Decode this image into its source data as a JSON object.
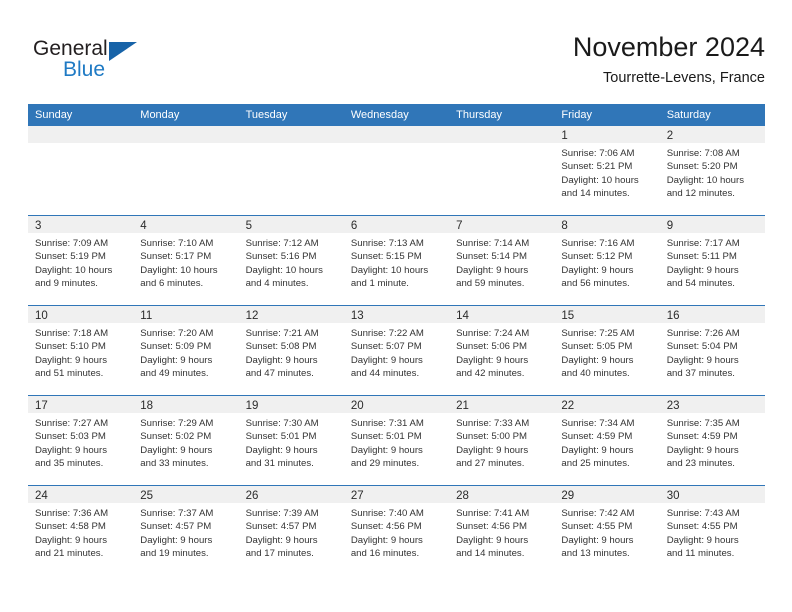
{
  "brand": {
    "name_part1": "General",
    "name_part2": "Blue",
    "accent_color": "#1f7ac4",
    "triangle_color": "#1763a8",
    "triangle_icon": "triangle-icon"
  },
  "header": {
    "month_title": "November 2024",
    "location": "Tourrette-Levens, France"
  },
  "calendar": {
    "header_bg": "#3076b8",
    "header_text_color": "#ffffff",
    "daynum_band_bg": "#f0f0f0",
    "weekdays": [
      "Sunday",
      "Monday",
      "Tuesday",
      "Wednesday",
      "Thursday",
      "Friday",
      "Saturday"
    ],
    "weeks": [
      [
        {
          "day": "",
          "empty": true,
          "lines": []
        },
        {
          "day": "",
          "empty": true,
          "lines": []
        },
        {
          "day": "",
          "empty": true,
          "lines": []
        },
        {
          "day": "",
          "empty": true,
          "lines": []
        },
        {
          "day": "",
          "empty": true,
          "lines": []
        },
        {
          "day": "1",
          "empty": false,
          "lines": [
            "Sunrise: 7:06 AM",
            "Sunset: 5:21 PM",
            "Daylight: 10 hours",
            "and 14 minutes."
          ]
        },
        {
          "day": "2",
          "empty": false,
          "lines": [
            "Sunrise: 7:08 AM",
            "Sunset: 5:20 PM",
            "Daylight: 10 hours",
            "and 12 minutes."
          ]
        }
      ],
      [
        {
          "day": "3",
          "empty": false,
          "lines": [
            "Sunrise: 7:09 AM",
            "Sunset: 5:19 PM",
            "Daylight: 10 hours",
            "and 9 minutes."
          ]
        },
        {
          "day": "4",
          "empty": false,
          "lines": [
            "Sunrise: 7:10 AM",
            "Sunset: 5:17 PM",
            "Daylight: 10 hours",
            "and 6 minutes."
          ]
        },
        {
          "day": "5",
          "empty": false,
          "lines": [
            "Sunrise: 7:12 AM",
            "Sunset: 5:16 PM",
            "Daylight: 10 hours",
            "and 4 minutes."
          ]
        },
        {
          "day": "6",
          "empty": false,
          "lines": [
            "Sunrise: 7:13 AM",
            "Sunset: 5:15 PM",
            "Daylight: 10 hours",
            "and 1 minute."
          ]
        },
        {
          "day": "7",
          "empty": false,
          "lines": [
            "Sunrise: 7:14 AM",
            "Sunset: 5:14 PM",
            "Daylight: 9 hours",
            "and 59 minutes."
          ]
        },
        {
          "day": "8",
          "empty": false,
          "lines": [
            "Sunrise: 7:16 AM",
            "Sunset: 5:12 PM",
            "Daylight: 9 hours",
            "and 56 minutes."
          ]
        },
        {
          "day": "9",
          "empty": false,
          "lines": [
            "Sunrise: 7:17 AM",
            "Sunset: 5:11 PM",
            "Daylight: 9 hours",
            "and 54 minutes."
          ]
        }
      ],
      [
        {
          "day": "10",
          "empty": false,
          "lines": [
            "Sunrise: 7:18 AM",
            "Sunset: 5:10 PM",
            "Daylight: 9 hours",
            "and 51 minutes."
          ]
        },
        {
          "day": "11",
          "empty": false,
          "lines": [
            "Sunrise: 7:20 AM",
            "Sunset: 5:09 PM",
            "Daylight: 9 hours",
            "and 49 minutes."
          ]
        },
        {
          "day": "12",
          "empty": false,
          "lines": [
            "Sunrise: 7:21 AM",
            "Sunset: 5:08 PM",
            "Daylight: 9 hours",
            "and 47 minutes."
          ]
        },
        {
          "day": "13",
          "empty": false,
          "lines": [
            "Sunrise: 7:22 AM",
            "Sunset: 5:07 PM",
            "Daylight: 9 hours",
            "and 44 minutes."
          ]
        },
        {
          "day": "14",
          "empty": false,
          "lines": [
            "Sunrise: 7:24 AM",
            "Sunset: 5:06 PM",
            "Daylight: 9 hours",
            "and 42 minutes."
          ]
        },
        {
          "day": "15",
          "empty": false,
          "lines": [
            "Sunrise: 7:25 AM",
            "Sunset: 5:05 PM",
            "Daylight: 9 hours",
            "and 40 minutes."
          ]
        },
        {
          "day": "16",
          "empty": false,
          "lines": [
            "Sunrise: 7:26 AM",
            "Sunset: 5:04 PM",
            "Daylight: 9 hours",
            "and 37 minutes."
          ]
        }
      ],
      [
        {
          "day": "17",
          "empty": false,
          "lines": [
            "Sunrise: 7:27 AM",
            "Sunset: 5:03 PM",
            "Daylight: 9 hours",
            "and 35 minutes."
          ]
        },
        {
          "day": "18",
          "empty": false,
          "lines": [
            "Sunrise: 7:29 AM",
            "Sunset: 5:02 PM",
            "Daylight: 9 hours",
            "and 33 minutes."
          ]
        },
        {
          "day": "19",
          "empty": false,
          "lines": [
            "Sunrise: 7:30 AM",
            "Sunset: 5:01 PM",
            "Daylight: 9 hours",
            "and 31 minutes."
          ]
        },
        {
          "day": "20",
          "empty": false,
          "lines": [
            "Sunrise: 7:31 AM",
            "Sunset: 5:01 PM",
            "Daylight: 9 hours",
            "and 29 minutes."
          ]
        },
        {
          "day": "21",
          "empty": false,
          "lines": [
            "Sunrise: 7:33 AM",
            "Sunset: 5:00 PM",
            "Daylight: 9 hours",
            "and 27 minutes."
          ]
        },
        {
          "day": "22",
          "empty": false,
          "lines": [
            "Sunrise: 7:34 AM",
            "Sunset: 4:59 PM",
            "Daylight: 9 hours",
            "and 25 minutes."
          ]
        },
        {
          "day": "23",
          "empty": false,
          "lines": [
            "Sunrise: 7:35 AM",
            "Sunset: 4:59 PM",
            "Daylight: 9 hours",
            "and 23 minutes."
          ]
        }
      ],
      [
        {
          "day": "24",
          "empty": false,
          "lines": [
            "Sunrise: 7:36 AM",
            "Sunset: 4:58 PM",
            "Daylight: 9 hours",
            "and 21 minutes."
          ]
        },
        {
          "day": "25",
          "empty": false,
          "lines": [
            "Sunrise: 7:37 AM",
            "Sunset: 4:57 PM",
            "Daylight: 9 hours",
            "and 19 minutes."
          ]
        },
        {
          "day": "26",
          "empty": false,
          "lines": [
            "Sunrise: 7:39 AM",
            "Sunset: 4:57 PM",
            "Daylight: 9 hours",
            "and 17 minutes."
          ]
        },
        {
          "day": "27",
          "empty": false,
          "lines": [
            "Sunrise: 7:40 AM",
            "Sunset: 4:56 PM",
            "Daylight: 9 hours",
            "and 16 minutes."
          ]
        },
        {
          "day": "28",
          "empty": false,
          "lines": [
            "Sunrise: 7:41 AM",
            "Sunset: 4:56 PM",
            "Daylight: 9 hours",
            "and 14 minutes."
          ]
        },
        {
          "day": "29",
          "empty": false,
          "lines": [
            "Sunrise: 7:42 AM",
            "Sunset: 4:55 PM",
            "Daylight: 9 hours",
            "and 13 minutes."
          ]
        },
        {
          "day": "30",
          "empty": false,
          "lines": [
            "Sunrise: 7:43 AM",
            "Sunset: 4:55 PM",
            "Daylight: 9 hours",
            "and 11 minutes."
          ]
        }
      ]
    ]
  }
}
